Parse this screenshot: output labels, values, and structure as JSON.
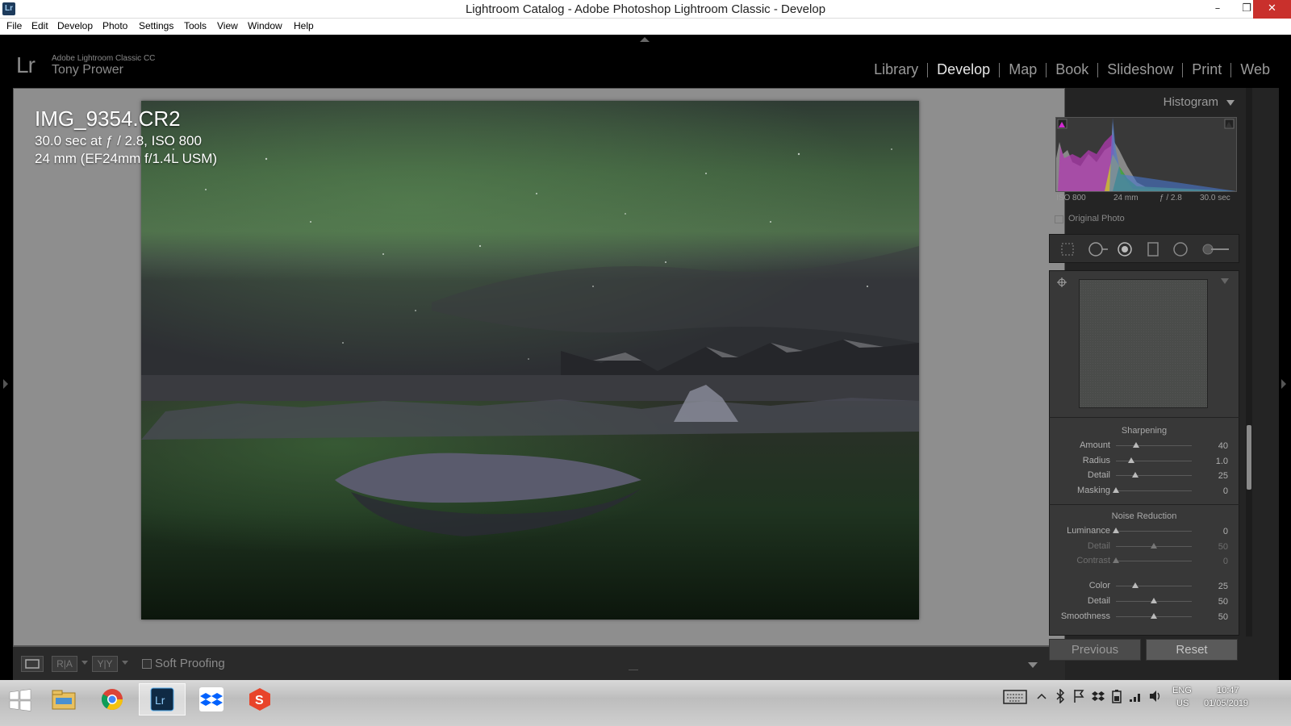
{
  "window": {
    "title": "Lightroom Catalog - Adobe Photoshop Lightroom Classic - Develop",
    "app_icon_text": "Lr",
    "controls": {
      "minimize": "–",
      "maximize": "❐",
      "close": "✕"
    }
  },
  "menubar": [
    "File",
    "Edit",
    "Develop",
    "Photo",
    "Settings",
    "Tools",
    "View",
    "Window",
    "Help"
  ],
  "identity": {
    "logo": "Lr",
    "product": "Adobe Lightroom Classic CC",
    "user": "Tony Prower"
  },
  "modules": {
    "items": [
      "Library",
      "Develop",
      "Map",
      "Book",
      "Slideshow",
      "Print",
      "Web"
    ],
    "active": "Develop"
  },
  "photo_info": {
    "filename": "IMG_9354.CR2",
    "exposure": "30.0 sec at ƒ / 2.8, ISO 800",
    "lens": "24 mm (EF24mm f/1.4L USM)"
  },
  "toolbar": {
    "view_ra": "R|A",
    "view_yy": "Y|Y",
    "soft_proofing": "Soft Proofing",
    "soft_proofing_checked": false
  },
  "histogram": {
    "title": "Histogram",
    "iso": "ISO 800",
    "focal": "24 mm",
    "aperture": "ƒ / 2.8",
    "shutter": "30.0 sec",
    "original_photo": "Original Photo"
  },
  "tools": [
    "crop-overlay-icon",
    "spot-removal-icon",
    "red-eye-icon",
    "graduated-filter-icon",
    "radial-filter-icon",
    "adjustment-brush-icon"
  ],
  "sharpening": {
    "title": "Sharpening",
    "sliders": [
      {
        "label": "Amount",
        "value": "40",
        "pos": 0.27
      },
      {
        "label": "Radius",
        "value": "1.0",
        "pos": 0.2
      },
      {
        "label": "Detail",
        "value": "25",
        "pos": 0.25
      },
      {
        "label": "Masking",
        "value": "0",
        "pos": 0.0
      }
    ]
  },
  "noise_reduction": {
    "title": "Noise Reduction",
    "sliders": [
      {
        "label": "Luminance",
        "value": "0",
        "pos": 0.0,
        "dim": false
      },
      {
        "label": "Detail",
        "value": "50",
        "pos": 0.5,
        "dim": true
      },
      {
        "label": "Contrast",
        "value": "0",
        "pos": 0.0,
        "dim": true
      },
      {
        "label": "Color",
        "value": "25",
        "pos": 0.25,
        "dim": false
      },
      {
        "label": "Detail",
        "value": "50",
        "pos": 0.5,
        "dim": false
      },
      {
        "label": "Smoothness",
        "value": "50",
        "pos": 0.5,
        "dim": false
      }
    ]
  },
  "buttons": {
    "previous": "Previous",
    "reset": "Reset"
  },
  "taskbar": {
    "apps": [
      "start-icon",
      "file-explorer-icon",
      "chrome-icon",
      "lightroom-icon",
      "dropbox-icon",
      "snagit-icon"
    ],
    "lang": "ENG",
    "region": "US",
    "time": "10:47",
    "date": "01/05/2019"
  }
}
